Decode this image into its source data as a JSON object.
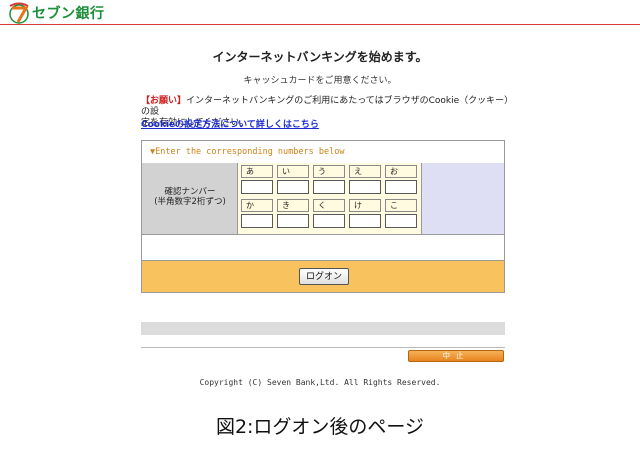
{
  "header": {
    "logo_text": "セブン銀行"
  },
  "page": {
    "title": "インターネットバンキングを始めます。",
    "subtitle": "キャッシュカードをご用意ください。"
  },
  "notice": {
    "tag": "【お願い】",
    "line1": "インターネットバンキングのご利用にあたってはブラウザのCookie（クッキー）の設",
    "line2": "定を有効にしてください。",
    "link": "Cookieの設定方法について詳しくはこちら"
  },
  "form": {
    "instruction": "▼Enter the corresponding numbers below",
    "label_line1": "確認ナンバー",
    "label_line2": "(半角数字2桁ずつ)",
    "row1_labels": [
      "あ",
      "い",
      "う",
      "え",
      "お"
    ],
    "row2_labels": [
      "か",
      "き",
      "く",
      "け",
      "こ"
    ],
    "logon_button": "ログオン"
  },
  "footer": {
    "stop_button": "中止",
    "copyright": "Copyright (C) Seven Bank,Ltd. All Rights Reserved."
  },
  "caption": "図2:ログオン後のページ",
  "colors": {
    "brand_green": "#1b8f3a",
    "brand_red": "#d73b3b",
    "accent_orange": "#f8c35e",
    "instruction_orange": "#d0831a",
    "link_blue": "#1a2ad0"
  }
}
